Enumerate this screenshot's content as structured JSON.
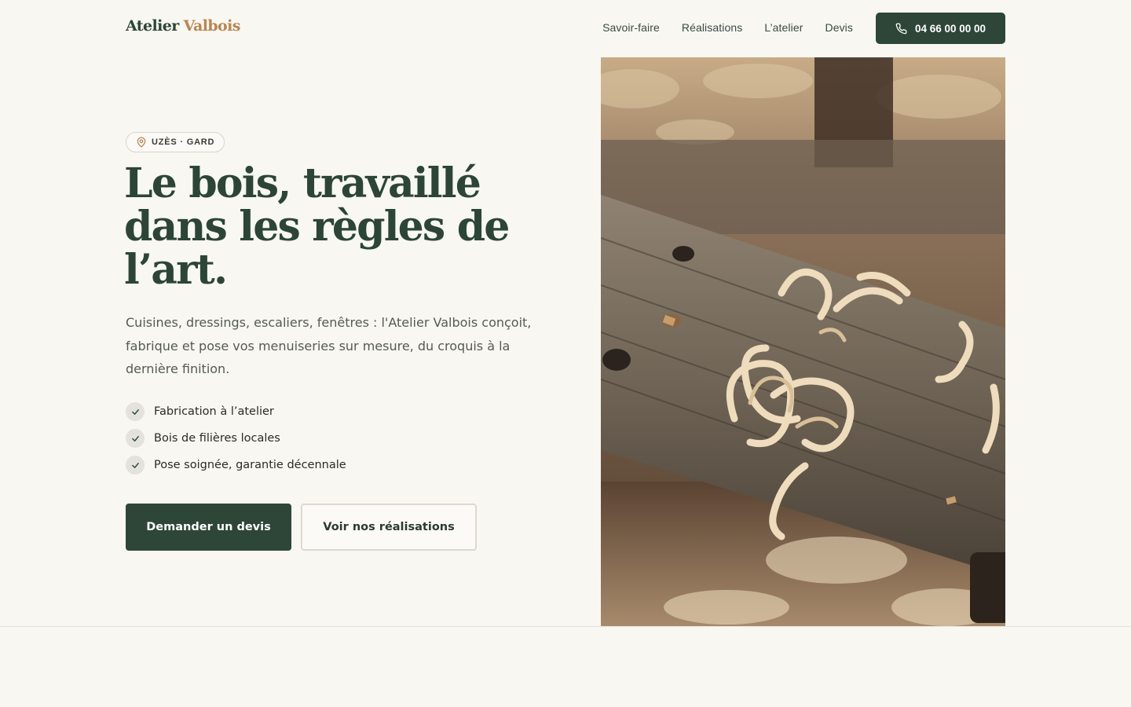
{
  "header": {
    "logo_primary": "Atelier",
    "logo_accent": "Valbois",
    "nav": [
      "Savoir-faire",
      "Réalisations",
      "L’atelier",
      "Devis"
    ],
    "phone": "04 66 00 00 00"
  },
  "hero": {
    "badge": "UZÈS · GARD",
    "headline": "Le bois, travaillé dans les règles de l’art.",
    "lead": "Cuisines, dressings, escaliers, fenêtres : l'Atelier Valbois conçoit, fabrique et pose vos menuiseries sur mesure, du croquis à la dernière finition.",
    "features": [
      "Fabrication à l’atelier",
      "Bois de filières locales",
      "Pose soignée, garantie décennale"
    ],
    "cta_primary": "Demander un devis",
    "cta_secondary": "Voir nos réalisations"
  },
  "colors": {
    "background": "#f8f7f2",
    "primary": "#2e4638",
    "accent": "#b98552"
  },
  "icons": {
    "phone": "phone-icon",
    "badge": "map-pin-icon",
    "feature": "check-icon"
  }
}
